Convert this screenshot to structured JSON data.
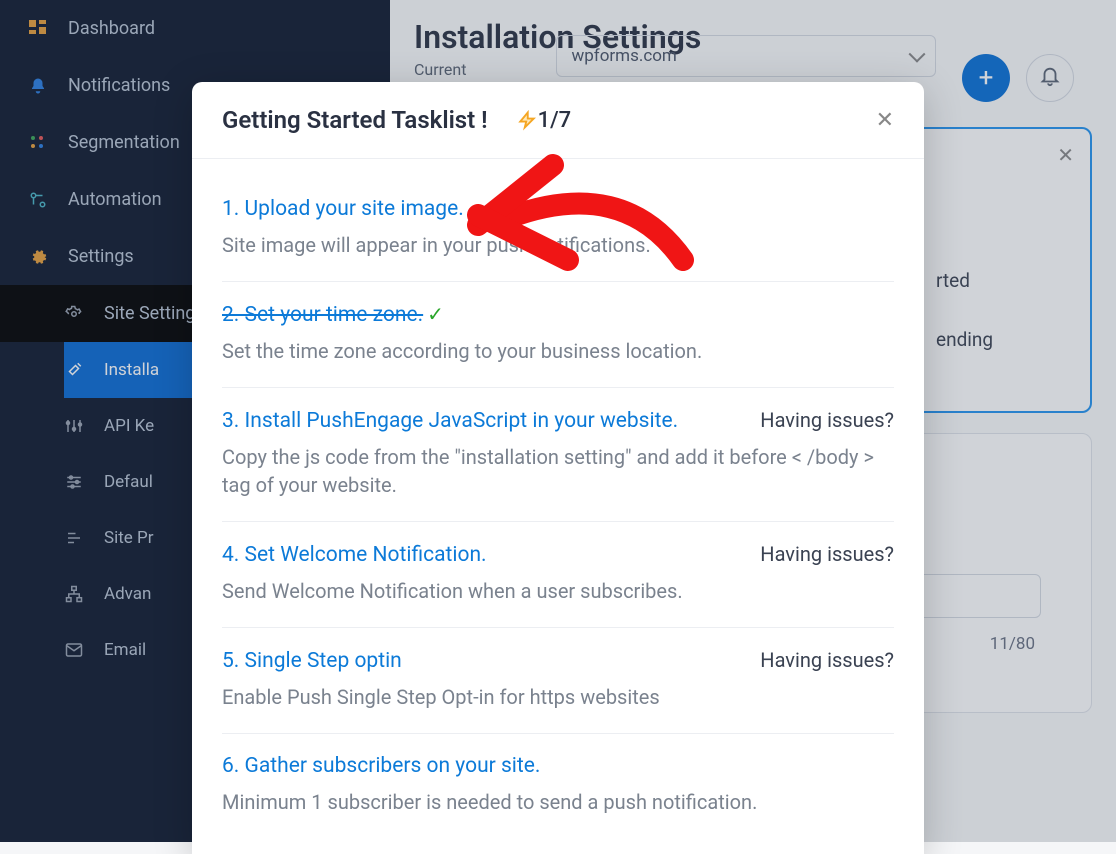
{
  "sidebar": {
    "items": [
      {
        "label": "Dashboard",
        "icon": "dashboard-icon"
      },
      {
        "label": "Notifications",
        "icon": "bell-icon"
      },
      {
        "label": "Segmentation",
        "icon": "segments-icon"
      },
      {
        "label": "Automation",
        "icon": "automation-icon"
      },
      {
        "label": "Settings",
        "icon": "gear-icon"
      }
    ],
    "sub": [
      {
        "label": "Site Settings",
        "icon": "gear-outline-icon"
      },
      {
        "label": "Installa",
        "icon": "wrench-icon"
      },
      {
        "label": "API Ke",
        "icon": "sliders-icon"
      },
      {
        "label": "Defaul",
        "icon": "tune-icon"
      },
      {
        "label": "Site Pr",
        "icon": "equalizer-icon"
      },
      {
        "label": "Advan",
        "icon": "hierarchy-icon"
      },
      {
        "label": "Email ",
        "icon": "mail-icon"
      }
    ]
  },
  "main": {
    "title": "Installation Settings",
    "current_label": "Current",
    "site_value": "wpforms.com",
    "card": {
      "line1": "rted",
      "line2": "ending"
    },
    "char_count": "11/80"
  },
  "modal": {
    "title": "Getting Started Tasklist !",
    "counter": "1/7",
    "tasks": [
      {
        "title": "1. Upload your site image.",
        "desc": "Site image will appear in your push notifications.",
        "done": false,
        "issues": false
      },
      {
        "title": "2. Set your time zone.",
        "desc": "Set the time zone according to your business location.",
        "done": true,
        "issues": false
      },
      {
        "title": "3. Install PushEngage JavaScript in your website.",
        "desc": "Copy the js code from the \"installation setting\" and add it before < /body > tag of your website.",
        "done": false,
        "issues": true
      },
      {
        "title": "4. Set Welcome Notification.",
        "desc": "Send Welcome Notification when a user subscribes.",
        "done": false,
        "issues": true
      },
      {
        "title": "5. Single Step optin",
        "desc": "Enable Push Single Step Opt-in for https websites",
        "done": false,
        "issues": true
      },
      {
        "title": "6. Gather subscribers on your site.",
        "desc": "Minimum 1 subscriber is needed to send a push notification.",
        "done": false,
        "issues": false
      }
    ],
    "issues_label": "Having issues?"
  }
}
